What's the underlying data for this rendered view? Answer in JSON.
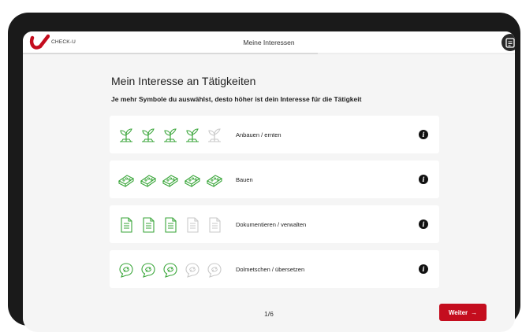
{
  "header": {
    "brand": "CHECK-U",
    "title": "Meine Interessen",
    "progress": 0.6
  },
  "main": {
    "heading": "Mein Interesse an Tätigkeiten",
    "subheading": "Je mehr Symbole du auswählst, desto höher ist dein Interesse für die Tätigkeit",
    "activities": [
      {
        "label": "Anbauen / ernten",
        "icon": "sprout-icon",
        "selected": 4,
        "max": 5
      },
      {
        "label": "Bauen",
        "icon": "brick-icon",
        "selected": 5,
        "max": 5
      },
      {
        "label": "Dokumentieren / verwalten",
        "icon": "document-icon",
        "selected": 3,
        "max": 5
      },
      {
        "label": "Dolmetschen / übersetzen",
        "icon": "speech-bubble-icon",
        "selected": 3,
        "max": 5
      }
    ]
  },
  "footer": {
    "page": "1/6",
    "next_label": "Weiter",
    "next_arrow": "→"
  },
  "colors": {
    "accent": "#c40d1e",
    "icon_active": "#3aa63a",
    "icon_inactive": "#c9c9c9",
    "background": "#f5f5f5"
  }
}
